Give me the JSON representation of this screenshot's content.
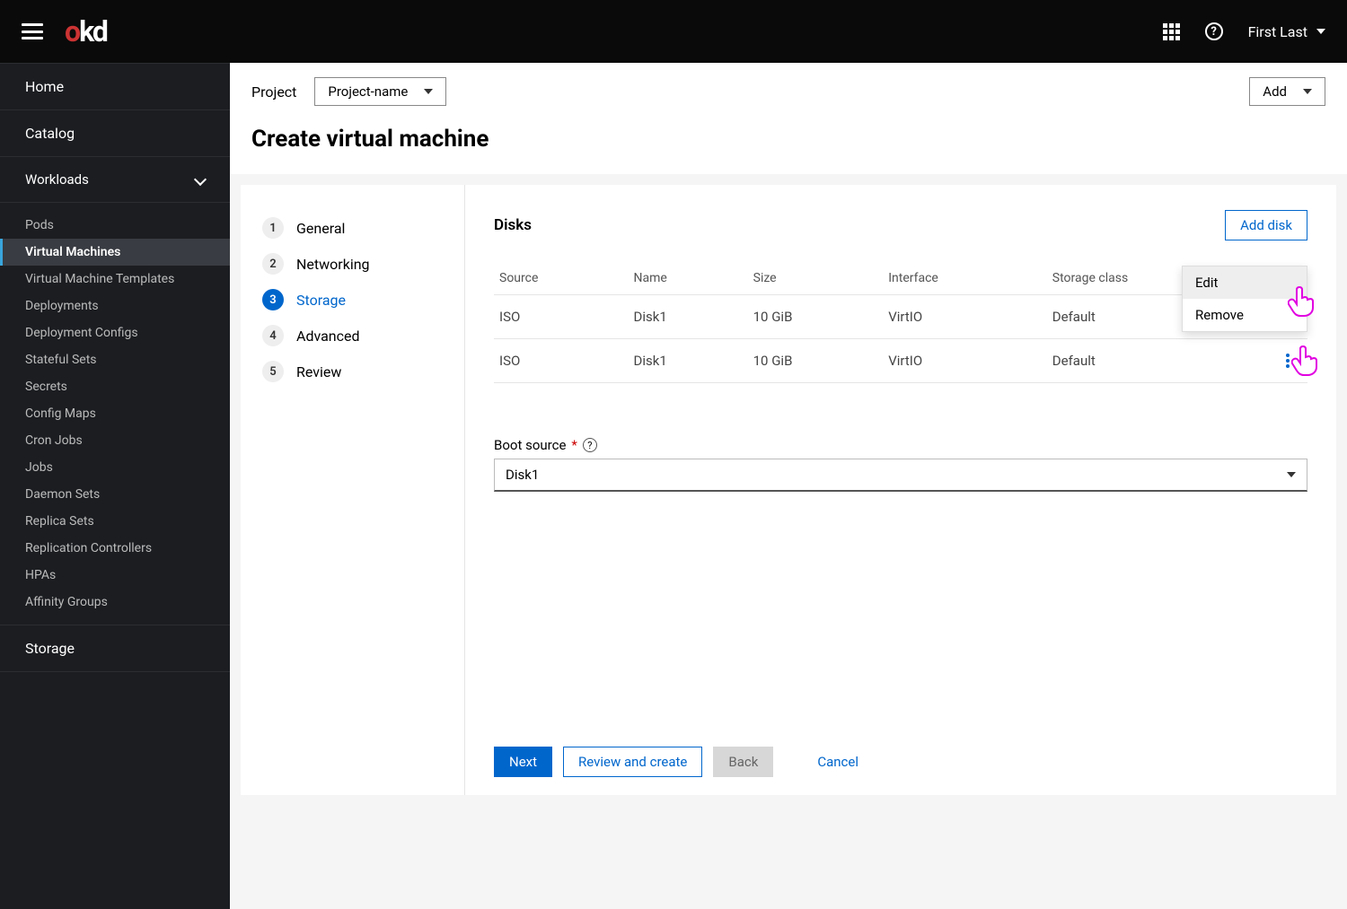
{
  "topbar": {
    "brand_o": "o",
    "brand_k": "k",
    "brand_d": "d",
    "user": "First Last"
  },
  "sidebar": {
    "home": "Home",
    "catalog": "Catalog",
    "workloads": "Workloads",
    "storage": "Storage",
    "items": [
      "Pods",
      "Virtual Machines",
      "Virtual Machine Templates",
      "Deployments",
      "Deployment Configs",
      "Stateful Sets",
      "Secrets",
      "Config Maps",
      "Cron Jobs",
      "Jobs",
      "Daemon Sets",
      "Replica Sets",
      "Replication Controllers",
      "HPAs",
      "Affinity Groups"
    ]
  },
  "toolbar": {
    "project_label": "Project",
    "project_value": "Project-name",
    "add": "Add"
  },
  "page": {
    "title": "Create virtual machine"
  },
  "wizard": {
    "steps": [
      {
        "num": "1",
        "label": "General"
      },
      {
        "num": "2",
        "label": "Networking"
      },
      {
        "num": "3",
        "label": "Storage"
      },
      {
        "num": "4",
        "label": "Advanced"
      },
      {
        "num": "5",
        "label": "Review"
      }
    ]
  },
  "disks": {
    "heading": "Disks",
    "add_btn": "Add disk",
    "columns": [
      "Source",
      "Name",
      "Size",
      "Interface",
      "Storage class"
    ],
    "rows": [
      {
        "source": "ISO",
        "name": "Disk1",
        "size": "10 GiB",
        "interface": "VirtIO",
        "class": "Default"
      },
      {
        "source": "ISO",
        "name": "Disk1",
        "size": "10 GiB",
        "interface": "VirtIO",
        "class": "Default"
      }
    ],
    "menu": {
      "edit": "Edit",
      "remove": "Remove"
    }
  },
  "boot": {
    "label": "Boot source",
    "value": "Disk1"
  },
  "footer": {
    "next": "Next",
    "review": "Review and create",
    "back": "Back",
    "cancel": "Cancel"
  }
}
